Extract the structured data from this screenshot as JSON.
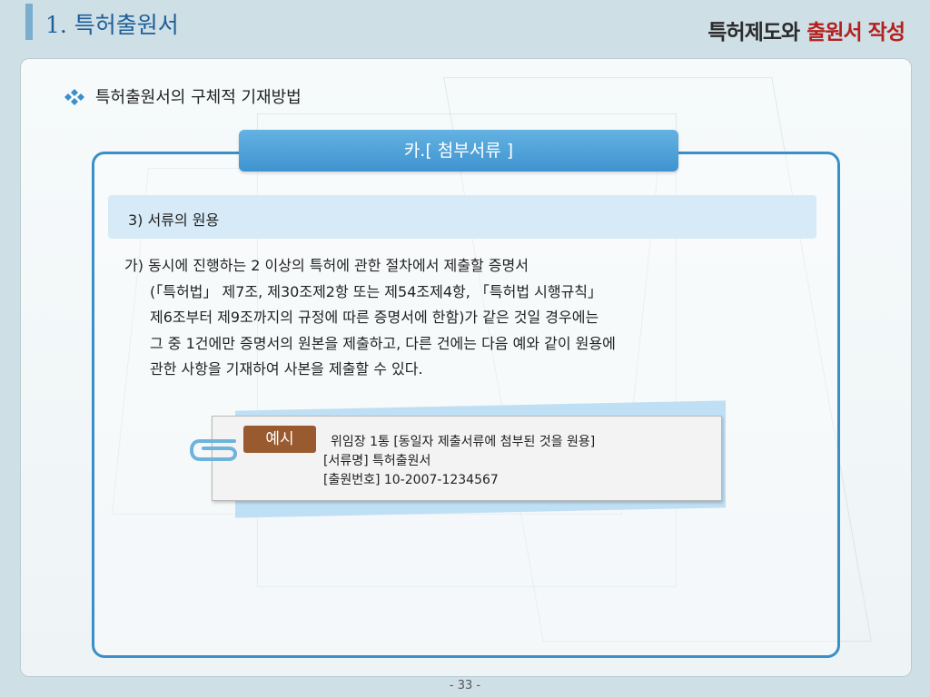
{
  "header": {
    "section_title": "1. 특허출원서",
    "right_title_dark": "특허제도와",
    "right_title_red": "출원서 작성"
  },
  "subtitle": "특허출원서의 구체적 기재방법",
  "tab_label": "카.[  첨부서류  ]",
  "section_label": "3)  서류의  원용",
  "body_lines": [
    "가) 동시에 진행하는 2 이상의 특허에 관한 절차에서 제출할 증명서",
    "(「특허법」 제7조, 제30조제2항 또는 제54조제4항, 「특허법 시행규칙」",
    "제6조부터 제9조까지의 규정에 따른 증명서에 한함)가 같은 것일 경우에는",
    "그 중 1건에만 증명서의 원본을 제출하고, 다른 건에는 다음 예와 같이 원용에",
    "관한 사항을 기재하여 사본을 제출할 수 있다."
  ],
  "example": {
    "badge": "예시",
    "lines": [
      "위임장 1통 [동일자 제출서류에 첨부된 것을 원용]",
      "[서류명] 특허출원서",
      "[출원번호] 10-2007-1234567"
    ]
  },
  "page_number": "- 33 -",
  "colors": {
    "accent_blue": "#3a8fc8",
    "title_blue": "#1d5f99",
    "title_red": "#b3211e",
    "badge_brown": "#9a5a2f"
  }
}
